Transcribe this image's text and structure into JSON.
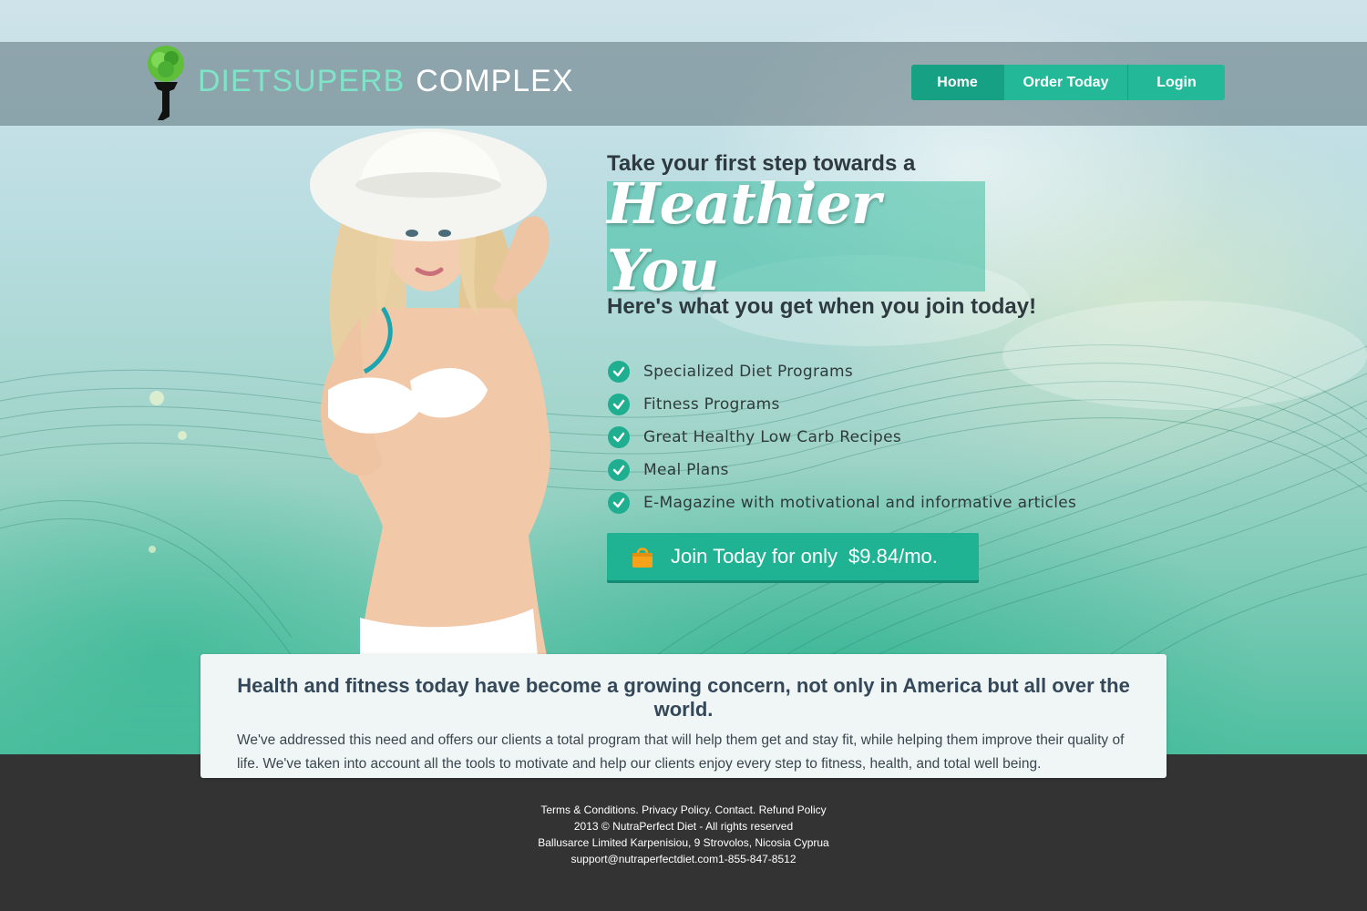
{
  "brand": {
    "name_part1": "DIETSUPERB",
    "name_part2": "COMPLEX",
    "accent_color": "#1fb394"
  },
  "nav": {
    "items": [
      {
        "label": "Home",
        "active": true
      },
      {
        "label": "Order Today",
        "active": false
      },
      {
        "label": "Login",
        "active": false
      }
    ]
  },
  "hero": {
    "tagline_top": "Take your first step towards a",
    "script_heading": "Heathier You",
    "tagline_sub": "Here's what you get when you join today!",
    "benefits": [
      "Specialized Diet Programs",
      "Fitness Programs",
      "Great Healthy Low Carb Recipes",
      "Meal Plans",
      "E-Magazine with motivational and informative articles"
    ],
    "cta": {
      "text": "Join Today for only",
      "price": "$9.84/mo.",
      "icon": "shopping-bag-icon"
    }
  },
  "info": {
    "title": "Health and fitness today have become a growing concern, not only in America but all over the world.",
    "body": "We've addressed this need and offers our clients a total program that will help them get and stay fit, while helping them improve their quality of life. We've taken into account all the tools to motivate and help our clients enjoy every step to fitness, health, and total well being."
  },
  "footer": {
    "links": [
      "Terms & Conditions.",
      "Privacy Policy.",
      "Contact.",
      "Refund Policy"
    ],
    "copyright": "2013 © NutraPerfect Diet - All rights reserved",
    "address": "Ballusarce Limited  Karpenisiou, 9 Strovolos, Nicosia Cyprua",
    "contact": "support@nutraperfectdiet.com1-855-847-8512"
  }
}
